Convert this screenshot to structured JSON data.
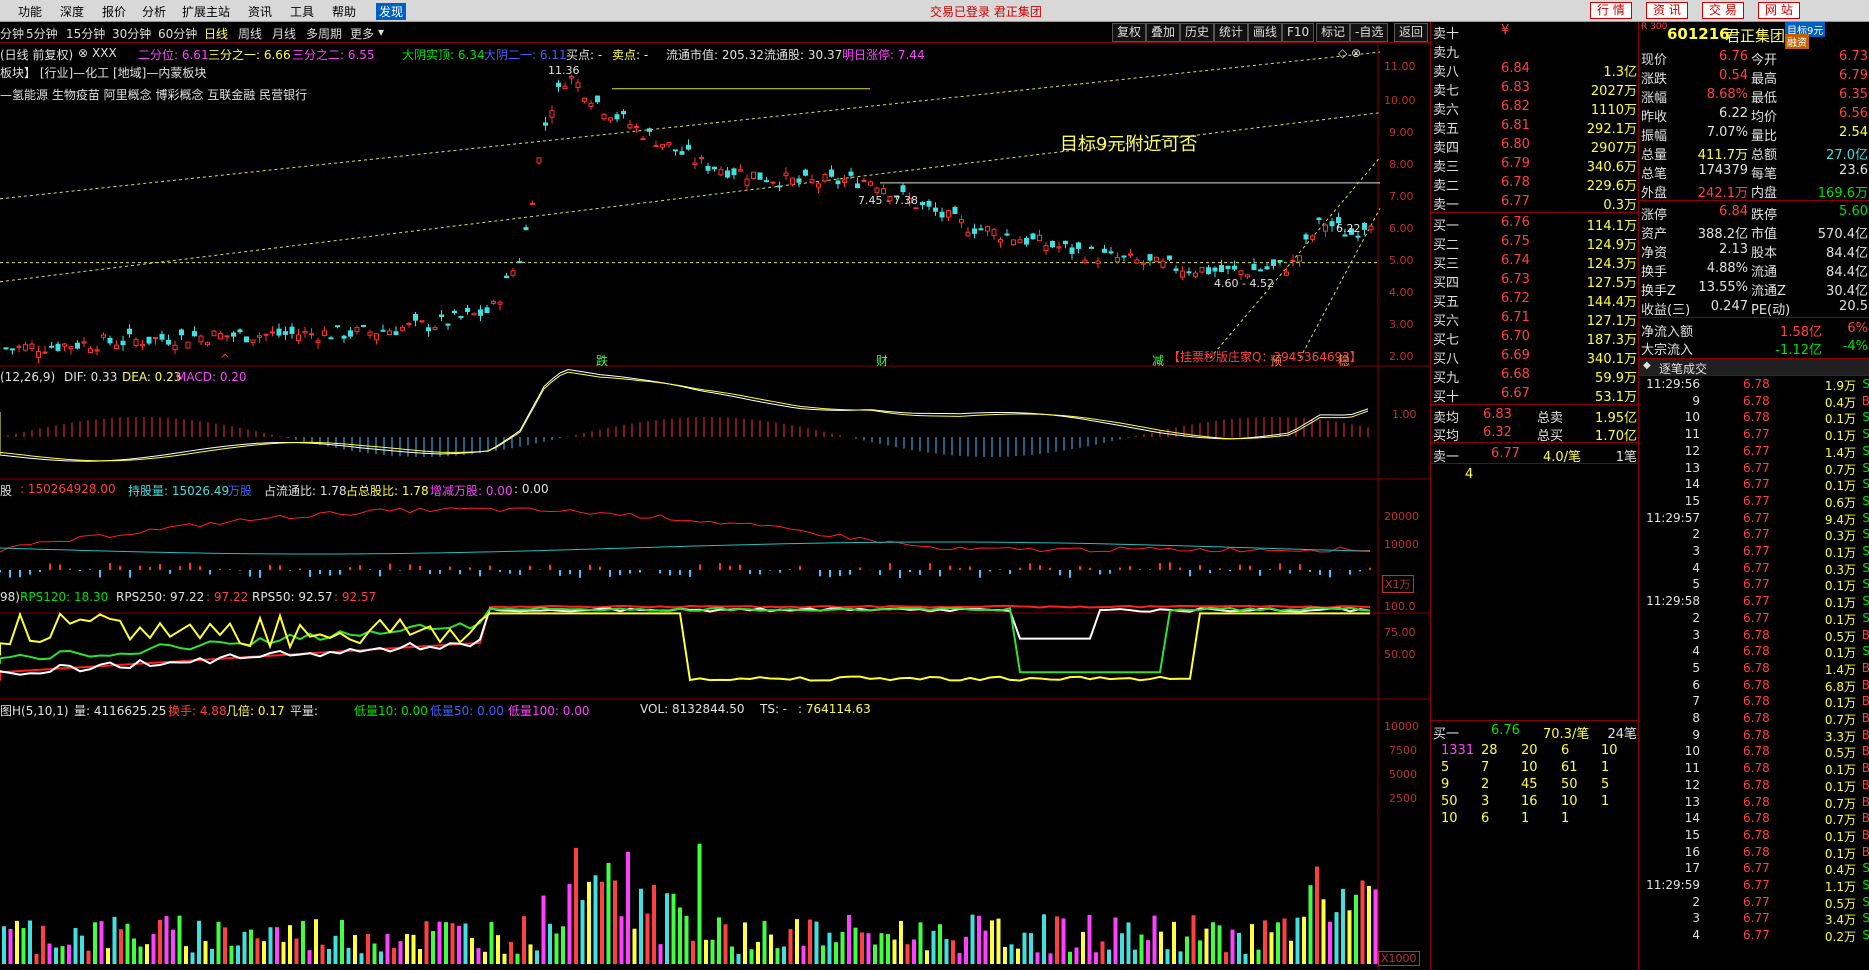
{
  "menu": [
    "功能",
    "深度",
    "报价",
    "分析",
    "扩展主站",
    "资讯",
    "工具",
    "帮助",
    "发现"
  ],
  "status": "交易已登录  君正集团",
  "top_buttons": [
    "行 情",
    "资 讯",
    "交 易",
    "网 站"
  ],
  "periods": [
    "分钟",
    "5分钟",
    "15分钟",
    "30分钟",
    "60分钟",
    "日线",
    "周线",
    "月线",
    "多周期",
    "更多"
  ],
  "toolbar": [
    "复权",
    "叠加",
    "历史",
    "统计",
    "画线",
    "F10",
    "标记",
    "-自选",
    "返回"
  ],
  "chart": {
    "header": {
      "mode": "(日线 前复权)",
      "code": "XXX",
      "l1": "二分位: 6.61",
      "l2": "三分之一: 6.66",
      "l3": "三分之二: 6.55",
      "l4": "大阴实顶: 6.34",
      "l5": "大阴二一: 6.11",
      "l6": "买点: -",
      "l7": "卖点: -",
      "l8": "流通市值: 205.32",
      "l9": "流通股: 30.37",
      "l10": "明日涨停: 7.44"
    },
    "sectors_1": "板块】  [行业]—化工   [地域]—内蒙板块",
    "sectors_2": "—氢能源 生物疫苗 阿里概念 博彩概念 互联金融 民营银行",
    "annotation": "目标9元附近可否",
    "price_label_1": "11.36",
    "price_label_2": "7.45 - 7.38",
    "price_label_3": "4.60 - 4.52",
    "price_label_4": "6.22",
    "banner": "【挂票秒版庄家Q：2945364693】",
    "price_axis": [
      "11.00",
      "10.00",
      "9.00",
      "8.00",
      "7.00",
      "6.00",
      "5.00",
      "4.00",
      "3.00",
      "2.00"
    ],
    "event_markers": [
      "跌",
      "财",
      "减",
      "预",
      "稳"
    ],
    "macd": {
      "label": "(12,26,9)",
      "dif": "DIF: 0.33",
      "dea": "DEA: 0.23",
      "macd": "MACD: 0.20",
      "axis": "1.00"
    },
    "holders": {
      "l1": "股",
      "l2": ": 150264928.00",
      "l3": "持股量: 15026.49",
      "l4": "万股",
      "l5": "占流通比: 1.78",
      "l6": "占总股比: 1.78",
      "l7": "增减万股: 0.00",
      "l8": ": 0.00",
      "axis": [
        "20000",
        "10000"
      ],
      "unit": "X1万"
    },
    "rps": {
      "l0": "98)",
      "l1": "RPS120: 18.30",
      "l2": "RPS250: 97.22",
      "l3": ": 97.22",
      "l4": "RPS50: 92.57",
      "l5": ": 92.57",
      "axis": [
        "100.0",
        "75.00",
        "50.00"
      ]
    },
    "vol": {
      "l1": "图H(5,10,1)",
      "l2": "量: 4116625.25",
      "l3": "换手: 4.88",
      "l4": "几倍: 0.17",
      "l5": "平量:",
      "l6": "低量10: 0.00",
      "l7": "低量50: 0.00",
      "l8": "低量100: 0.00",
      "l9": "VOL: 8132844.50",
      "l10": "TS: -",
      "l11": ": 764114.63",
      "axis": [
        "10000",
        "7500",
        "5000",
        "2500"
      ],
      "unit": "X1000"
    }
  },
  "quote": {
    "sell": [
      [
        "卖十",
        "¥",
        ""
      ],
      [
        "卖九",
        "",
        ""
      ],
      [
        "卖八",
        "6.84",
        "1.3亿"
      ],
      [
        "卖七",
        "6.83",
        "2027万"
      ],
      [
        "卖六",
        "6.82",
        "1110万"
      ],
      [
        "卖五",
        "6.81",
        "292.1万"
      ],
      [
        "卖四",
        "6.80",
        "2907万"
      ],
      [
        "卖三",
        "6.79",
        "340.6万"
      ],
      [
        "卖二",
        "6.78",
        "229.6万"
      ],
      [
        "卖一",
        "6.77",
        "0.3万"
      ]
    ],
    "buy": [
      [
        "买一",
        "6.76",
        "114.1万"
      ],
      [
        "买二",
        "6.75",
        "124.9万"
      ],
      [
        "买三",
        "6.74",
        "124.3万"
      ],
      [
        "买四",
        "6.73",
        "127.5万"
      ],
      [
        "买五",
        "6.72",
        "144.4万"
      ],
      [
        "买六",
        "6.71",
        "127.1万"
      ],
      [
        "买七",
        "6.70",
        "187.3万"
      ],
      [
        "买八",
        "6.69",
        "340.1万"
      ],
      [
        "买九",
        "6.68",
        "59.9万"
      ],
      [
        "买十",
        "6.67",
        "53.1万"
      ]
    ],
    "avg": [
      [
        "卖均",
        "6.83",
        "总卖",
        "1.95亿"
      ],
      [
        "买均",
        "6.32",
        "总买",
        "1.70亿"
      ]
    ],
    "sell1": [
      "卖一",
      "6.77",
      "4.0/笔",
      "1笔"
    ],
    "sell1_count": "4",
    "buy1": [
      "买一",
      "6.76",
      "70.3/笔",
      "24笔"
    ],
    "queue": [
      [
        "1331",
        "28",
        "20",
        "6",
        "10"
      ],
      [
        "5",
        "7",
        "10",
        "61",
        "1"
      ],
      [
        "9",
        "2",
        "45",
        "50",
        "5"
      ],
      [
        "50",
        "3",
        "16",
        "10",
        "1"
      ],
      [
        "10",
        "6",
        "1",
        "1",
        ""
      ]
    ]
  },
  "info": {
    "code": "601216",
    "name": "君正集团",
    "badge": "目标9元",
    "badge2": "融资",
    "exch": "R 300",
    "stats": [
      [
        "现价",
        "6.76",
        "今开",
        "6.73"
      ],
      [
        "涨跌",
        "0.54",
        "最高",
        "6.79"
      ],
      [
        "涨幅",
        "8.68%",
        "最低",
        "6.35"
      ],
      [
        "昨收",
        "6.22",
        "均价",
        "6.56"
      ],
      [
        "振幅",
        "7.07%",
        "量比",
        "2.54"
      ],
      [
        "总量",
        "411.7万",
        "总额",
        "27.0亿"
      ],
      [
        "总笔",
        "174379",
        "每笔",
        "23.6"
      ],
      [
        "外盘",
        "242.1万",
        "内盘",
        "169.6万"
      ]
    ],
    "stats2": [
      [
        "涨停",
        "6.84",
        "跌停",
        "5.60"
      ],
      [
        "资产",
        "388.2亿",
        "市值",
        "570.4亿"
      ],
      [
        "净资",
        "2.13",
        "股本",
        "84.4亿"
      ],
      [
        "换手",
        "4.88%",
        "流通",
        "84.4亿"
      ],
      [
        "换手Z",
        "13.55%",
        "流通Z",
        "30.4亿"
      ],
      [
        "收益(三)",
        "0.247",
        "PE(动)",
        "20.5"
      ]
    ],
    "flow": [
      [
        "净流入额",
        "1.58亿",
        "6%"
      ],
      [
        "大宗流入",
        "-1.12亿",
        "-4%"
      ]
    ],
    "ticks_title": "逐笔成交",
    "ticks": [
      [
        "11:29:56",
        "6.78",
        "1.9万",
        "S"
      ],
      [
        "9",
        "6.78",
        "0.4万",
        "B"
      ],
      [
        "10",
        "6.78",
        "0.1万",
        "S"
      ],
      [
        "11",
        "6.77",
        "0.1万",
        "S"
      ],
      [
        "12",
        "6.77",
        "1.4万",
        "S"
      ],
      [
        "13",
        "6.77",
        "0.7万",
        "S"
      ],
      [
        "14",
        "6.77",
        "0.1万",
        "S"
      ],
      [
        "15",
        "6.77",
        "0.6万",
        "S"
      ],
      [
        "11:29:57",
        "6.77",
        "9.4万",
        "S"
      ],
      [
        "2",
        "6.77",
        "0.3万",
        "S"
      ],
      [
        "3",
        "6.77",
        "0.1万",
        "S"
      ],
      [
        "4",
        "6.77",
        "0.3万",
        "S"
      ],
      [
        "5",
        "6.77",
        "0.1万",
        "S"
      ],
      [
        "11:29:58",
        "6.77",
        "0.1万",
        "S"
      ],
      [
        "2",
        "6.77",
        "0.1万",
        "S"
      ],
      [
        "3",
        "6.78",
        "0.5万",
        "B"
      ],
      [
        "4",
        "6.78",
        "0.1万",
        "S"
      ],
      [
        "5",
        "6.78",
        "1.4万",
        "B"
      ],
      [
        "6",
        "6.78",
        "6.8万",
        "B"
      ],
      [
        "7",
        "6.78",
        "0.1万",
        "B"
      ],
      [
        "8",
        "6.78",
        "0.7万",
        "B"
      ],
      [
        "9",
        "6.78",
        "3.3万",
        "B"
      ],
      [
        "10",
        "6.78",
        "0.5万",
        "B"
      ],
      [
        "11",
        "6.78",
        "0.1万",
        "B"
      ],
      [
        "12",
        "6.78",
        "0.1万",
        "B"
      ],
      [
        "13",
        "6.78",
        "0.7万",
        "B"
      ],
      [
        "14",
        "6.78",
        "0.7万",
        "B"
      ],
      [
        "15",
        "6.78",
        "0.1万",
        "B"
      ],
      [
        "16",
        "6.78",
        "0.1万",
        "B"
      ],
      [
        "17",
        "6.77",
        "0.4万",
        "S"
      ],
      [
        "11:29:59",
        "6.77",
        "1.1万",
        "S"
      ],
      [
        "2",
        "6.77",
        "0.5万",
        "S"
      ],
      [
        "3",
        "6.77",
        "3.4万",
        "S"
      ],
      [
        "4",
        "6.77",
        "0.2万",
        "S"
      ]
    ]
  }
}
